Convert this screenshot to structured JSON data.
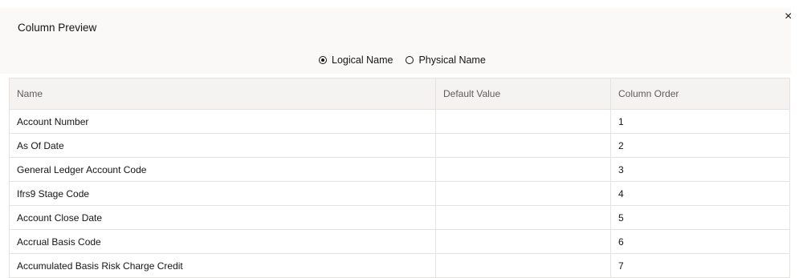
{
  "dialog": {
    "title": "Column Preview",
    "close_icon": "×"
  },
  "radio_group": {
    "options": [
      {
        "label": "Logical Name",
        "checked": true
      },
      {
        "label": "Physical Name",
        "checked": false
      }
    ]
  },
  "table": {
    "headers": [
      "Name",
      "Default Value",
      "Column Order"
    ],
    "rows": [
      {
        "name": "Account Number",
        "default_value": "",
        "order": "1"
      },
      {
        "name": "As Of Date",
        "default_value": "",
        "order": "2"
      },
      {
        "name": "General Ledger Account Code",
        "default_value": "",
        "order": "3"
      },
      {
        "name": "Ifrs9 Stage Code",
        "default_value": "",
        "order": "4"
      },
      {
        "name": "Account Close Date",
        "default_value": "",
        "order": "5"
      },
      {
        "name": "Accrual Basis Code",
        "default_value": "",
        "order": "6"
      },
      {
        "name": "Accumulated Basis Risk Charge Credit",
        "default_value": "",
        "order": "7"
      }
    ]
  }
}
